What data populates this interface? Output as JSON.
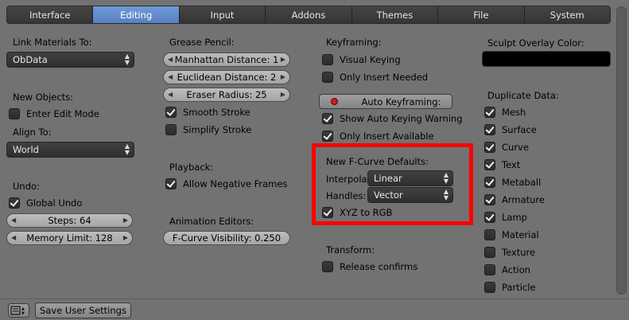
{
  "tabs": [
    "Interface",
    "Editing",
    "Input",
    "Addons",
    "Themes",
    "File",
    "System"
  ],
  "active_tab": "Editing",
  "col1": {
    "link_materials_label": "Link Materials To:",
    "link_materials_value": "ObData",
    "new_objects_label": "New Objects:",
    "enter_edit_mode": "Enter Edit Mode",
    "align_to_label": "Align To:",
    "align_to_value": "World",
    "undo_label": "Undo:",
    "global_undo": "Global Undo",
    "steps": "Steps: 64",
    "memory_limit": "Memory Limit: 128"
  },
  "col2": {
    "grease_pencil_label": "Grease Pencil:",
    "manhattan": "Manhattan Distance: 1",
    "euclidean": "Euclidean Distance: 2",
    "eraser": "Eraser Radius: 25",
    "smooth_stroke": "Smooth Stroke",
    "simplify_stroke": "Simplify Stroke",
    "playback_label": "Playback:",
    "allow_negative": "Allow Negative Frames",
    "anim_editors_label": "Animation Editors:",
    "fcurve_visibility": "F-Curve Visibility: 0.250"
  },
  "col3": {
    "keyframing_label": "Keyframing:",
    "visual_keying": "Visual Keying",
    "only_insert_needed": "Only Insert Needed",
    "auto_keyframing": "Auto Keyframing:",
    "show_auto_keying_warning": "Show Auto Keying Warning",
    "only_insert_available": "Only Insert Available",
    "fcurve_defaults_label": "New F-Curve Defaults:",
    "interpola_label": "Interpola",
    "interpola_value": "Linear",
    "handles_label": "Handles:",
    "handles_value": "Vector",
    "xyz_to_rgb": "XYZ to RGB",
    "transform_label": "Transform:",
    "release_confirms": "Release confirms"
  },
  "col4": {
    "sculpt_overlay_label": "Sculpt Overlay Color:",
    "sculpt_overlay_color": "#000000",
    "duplicate_data_label": "Duplicate Data:",
    "items": [
      {
        "label": "Mesh",
        "checked": true
      },
      {
        "label": "Surface",
        "checked": true
      },
      {
        "label": "Curve",
        "checked": true
      },
      {
        "label": "Text",
        "checked": true
      },
      {
        "label": "Metaball",
        "checked": true
      },
      {
        "label": "Armature",
        "checked": true
      },
      {
        "label": "Lamp",
        "checked": true
      },
      {
        "label": "Material",
        "checked": false
      },
      {
        "label": "Texture",
        "checked": false
      },
      {
        "label": "Action",
        "checked": false
      },
      {
        "label": "Particle",
        "checked": false
      }
    ]
  },
  "bottom": {
    "save_user_settings": "Save User Settings"
  },
  "colors": {
    "accent_tab": "#5f8acb",
    "highlight_border": "#ff0000",
    "background": "#727272"
  }
}
